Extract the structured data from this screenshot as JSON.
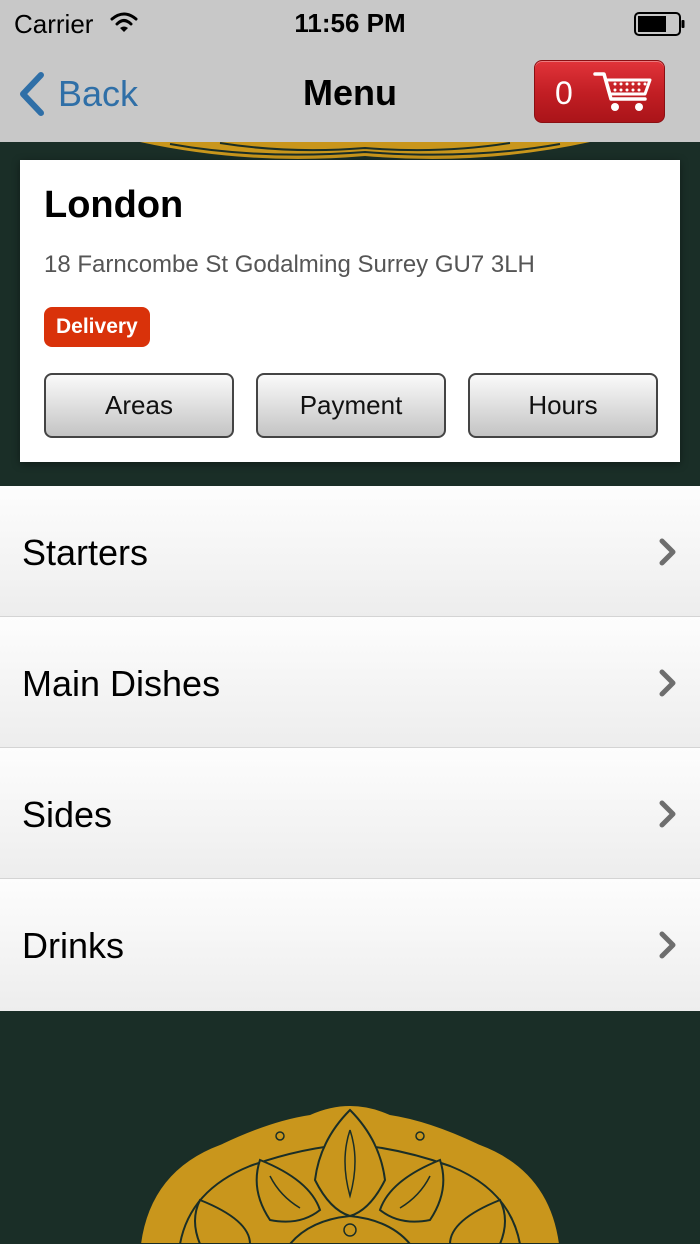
{
  "status_bar": {
    "carrier": "Carrier",
    "time": "11:56 PM",
    "wifi_icon": "wifi-icon",
    "battery_icon": "battery-icon"
  },
  "nav": {
    "back_label": "Back",
    "title": "Menu",
    "cart_count": "0",
    "cart_icon": "shopping-cart-icon",
    "back_color": "#2f6fa7",
    "cart_color": "#c21e24"
  },
  "store": {
    "name": "London",
    "address": "18 Farncombe St Godalming Surrey GU7 3LH",
    "badge": "Delivery",
    "badge_color": "#d9320a",
    "buttons": [
      "Areas",
      "Payment",
      "Hours"
    ]
  },
  "menu": {
    "items": [
      "Starters",
      "Main Dishes",
      "Sides",
      "Drinks"
    ]
  },
  "theme": {
    "background": "#1a2e27",
    "ornament": "#c9961c"
  }
}
